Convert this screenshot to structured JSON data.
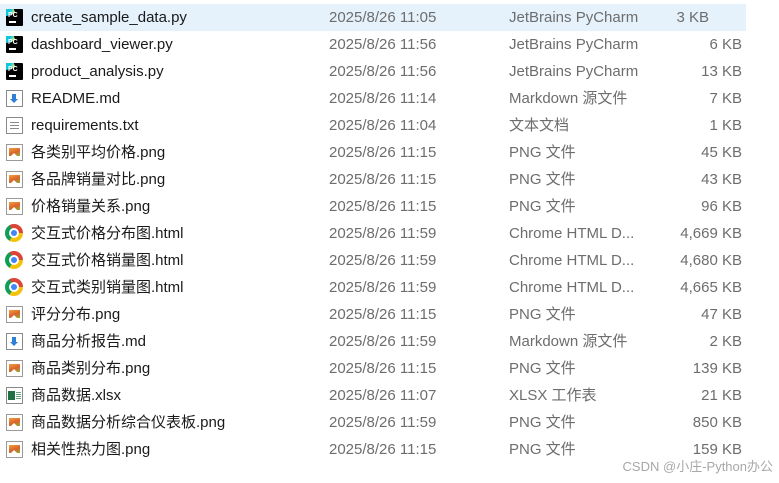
{
  "files": [
    {
      "name": "create_sample_data.py",
      "date": "2025/8/26 11:05",
      "type": "JetBrains PyCharm",
      "size": "3 KB",
      "icon": "pycharm-icon",
      "selected": true
    },
    {
      "name": "dashboard_viewer.py",
      "date": "2025/8/26 11:56",
      "type": "JetBrains PyCharm",
      "size": "6 KB",
      "icon": "pycharm-icon"
    },
    {
      "name": "product_analysis.py",
      "date": "2025/8/26 11:56",
      "type": "JetBrains PyCharm",
      "size": "13 KB",
      "icon": "pycharm-icon"
    },
    {
      "name": "README.md",
      "date": "2025/8/26 11:14",
      "type": "Markdown 源文件",
      "size": "7 KB",
      "icon": "markdown-file-icon"
    },
    {
      "name": "requirements.txt",
      "date": "2025/8/26 11:04",
      "type": "文本文档",
      "size": "1 KB",
      "icon": "text-file-icon"
    },
    {
      "name": "各类别平均价格.png",
      "date": "2025/8/26 11:15",
      "type": "PNG 文件",
      "size": "45 KB",
      "icon": "png-image-icon"
    },
    {
      "name": "各品牌销量对比.png",
      "date": "2025/8/26 11:15",
      "type": "PNG 文件",
      "size": "43 KB",
      "icon": "png-image-icon"
    },
    {
      "name": "价格销量关系.png",
      "date": "2025/8/26 11:15",
      "type": "PNG 文件",
      "size": "96 KB",
      "icon": "png-image-icon"
    },
    {
      "name": "交互式价格分布图.html",
      "date": "2025/8/26 11:59",
      "type": "Chrome HTML D...",
      "size": "4,669 KB",
      "icon": "chrome-icon"
    },
    {
      "name": "交互式价格销量图.html",
      "date": "2025/8/26 11:59",
      "type": "Chrome HTML D...",
      "size": "4,680 KB",
      "icon": "chrome-icon"
    },
    {
      "name": "交互式类别销量图.html",
      "date": "2025/8/26 11:59",
      "type": "Chrome HTML D...",
      "size": "4,665 KB",
      "icon": "chrome-icon"
    },
    {
      "name": "评分分布.png",
      "date": "2025/8/26 11:15",
      "type": "PNG 文件",
      "size": "47 KB",
      "icon": "png-image-icon"
    },
    {
      "name": "商品分析报告.md",
      "date": "2025/8/26 11:59",
      "type": "Markdown 源文件",
      "size": "2 KB",
      "icon": "markdown-file-icon"
    },
    {
      "name": "商品类别分布.png",
      "date": "2025/8/26 11:15",
      "type": "PNG 文件",
      "size": "139 KB",
      "icon": "png-image-icon"
    },
    {
      "name": "商品数据.xlsx",
      "date": "2025/8/26 11:07",
      "type": "XLSX 工作表",
      "size": "21 KB",
      "icon": "xlsx-file-icon"
    },
    {
      "name": "商品数据分析综合仪表板.png",
      "date": "2025/8/26 11:59",
      "type": "PNG 文件",
      "size": "850 KB",
      "icon": "png-image-icon"
    },
    {
      "name": "相关性热力图.png",
      "date": "2025/8/26 11:15",
      "type": "PNG 文件",
      "size": "159 KB",
      "icon": "png-image-icon"
    }
  ],
  "watermark": "CSDN @小庄-Python办公",
  "colors": {
    "selected_row_bg": "#e5f1fb",
    "primary_text": "#1a1a1a",
    "secondary_text": "#6d6d6d"
  }
}
